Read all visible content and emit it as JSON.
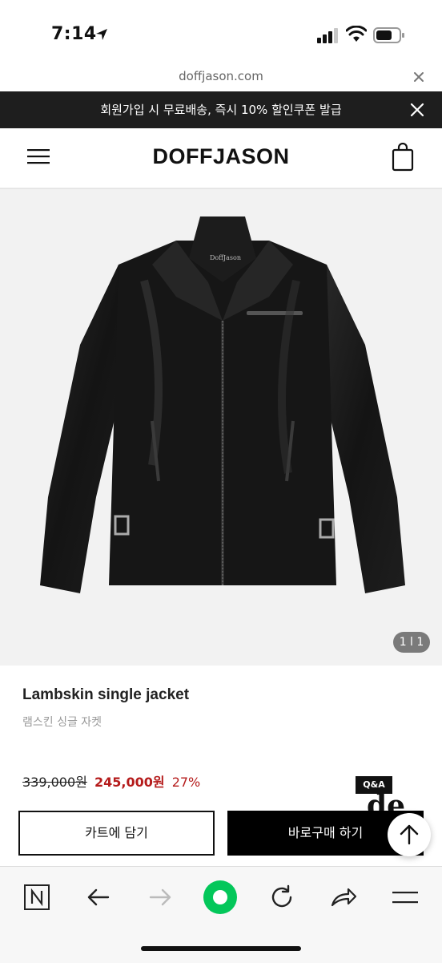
{
  "status_bar": {
    "time": "7:14"
  },
  "browser": {
    "url": "doffjason.com"
  },
  "promo": {
    "text": "회원가입 시 무료배송, 즉시 10% 할인쿠폰 발급"
  },
  "header": {
    "logo": "DOFFJASON"
  },
  "gallery": {
    "counter": "1 l 1",
    "garment_label": "DoffJason"
  },
  "product": {
    "name": "Lambskin single jacket",
    "subtitle": "램스킨 싱글 자켓",
    "original_price": "339,000원",
    "sale_price": "245,000원",
    "discount": "27%"
  },
  "qa_badge": {
    "label": "Q&A",
    "deco": "de"
  },
  "actions": {
    "cart_label": "카트에 담기",
    "buy_label": "바로구매 하기"
  },
  "colors": {
    "promo_bg": "#1e1e1e",
    "sale_red": "#b51b1b",
    "brand_green": "#03c75a"
  },
  "toolbar_icons": [
    "naver-icon",
    "back-arrow-icon",
    "forward-arrow-icon",
    "home-circle-icon",
    "reload-icon",
    "share-icon",
    "menu-icon"
  ]
}
